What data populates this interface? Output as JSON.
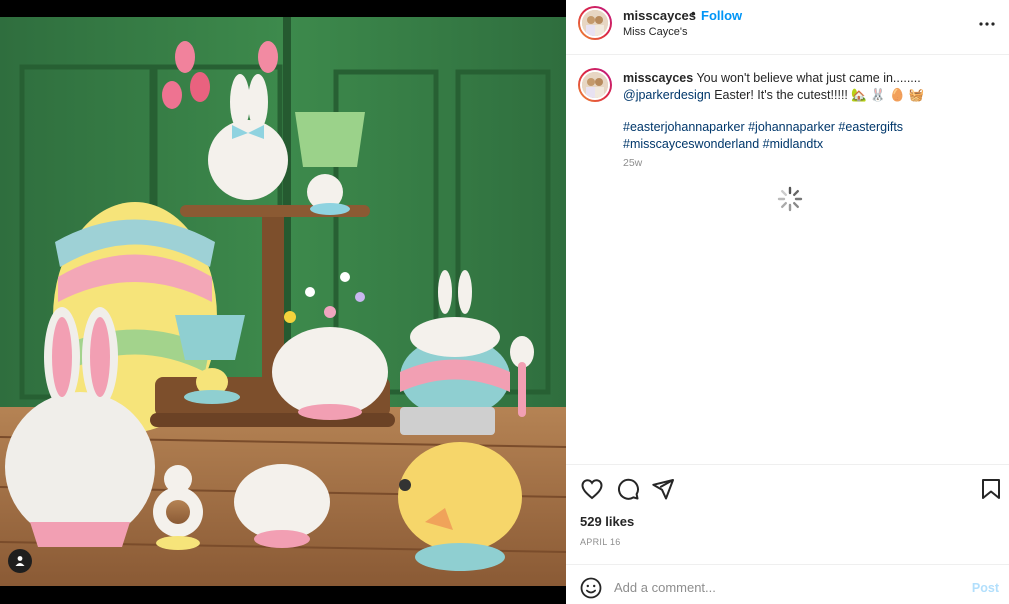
{
  "post": {
    "username": "misscayces",
    "follow_label": "Follow",
    "separator": "•",
    "subtitle": "Miss Cayce's"
  },
  "caption": {
    "username": "misscayces",
    "text_1": " You won't believe what just came in........ ",
    "mention": "@jparkerdesign",
    "text_2": " Easter! It's the cutest!!!!! 🏡 🐰 🥚 🧺",
    "hashtags_line1": "#easterjohannaparker #johannaparker #eastergifts",
    "hashtags_line2": "#misscayceswonderland #midlandtx",
    "age": "25w"
  },
  "engagement": {
    "likes": "529 likes",
    "date": "APRIL 16"
  },
  "comment": {
    "placeholder": "Add a comment...",
    "post_label": "Post"
  },
  "icons": {
    "user_tag": "user-tag-icon",
    "more": "more-options-icon",
    "like": "heart-icon",
    "comment": "comment-bubble-icon",
    "share": "paper-plane-icon",
    "save": "bookmark-icon",
    "emoji": "emoji-smiley-icon",
    "loading": "loading-spinner-icon"
  },
  "colors": {
    "follow": "#0095f6",
    "link": "#00376b",
    "muted": "#8e8e8e",
    "post_disabled": "#b2dffc"
  }
}
